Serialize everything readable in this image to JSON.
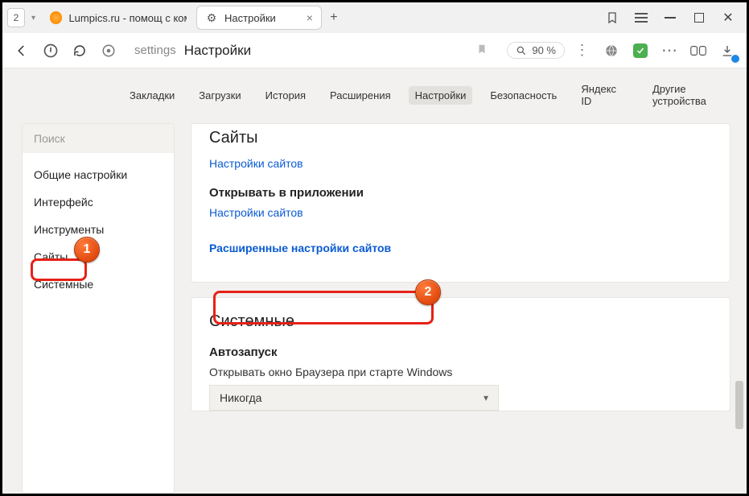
{
  "titlebar": {
    "group_count": "2",
    "tab_lumpics": "Lumpics.ru - помощ с ком",
    "tab_settings": "Настройки"
  },
  "toolbar": {
    "host": "settings",
    "page_title": "Настройки",
    "zoom": "90 %"
  },
  "topnav": {
    "bookmarks": "Закладки",
    "downloads": "Загрузки",
    "history": "История",
    "extensions": "Расширения",
    "settings": "Настройки",
    "security": "Безопасность",
    "yandex_id": "Яндекс ID",
    "other_devices": "Другие устройства"
  },
  "sidebar": {
    "search_placeholder": "Поиск",
    "items": [
      "Общие настройки",
      "Интерфейс",
      "Инструменты",
      "Сайты",
      "Системные"
    ]
  },
  "main": {
    "sites": {
      "heading": "Сайты",
      "link1": "Настройки сайтов",
      "subheading": "Открывать в приложении",
      "link2": "Настройки сайтов",
      "advanced": "Расширенные настройки сайтов"
    },
    "system": {
      "heading": "Системные",
      "autostart": "Автозапуск",
      "autostart_desc": "Открывать окно Браузера при старте Windows",
      "autostart_value": "Никогда"
    }
  },
  "badges": {
    "b1": "1",
    "b2": "2"
  }
}
